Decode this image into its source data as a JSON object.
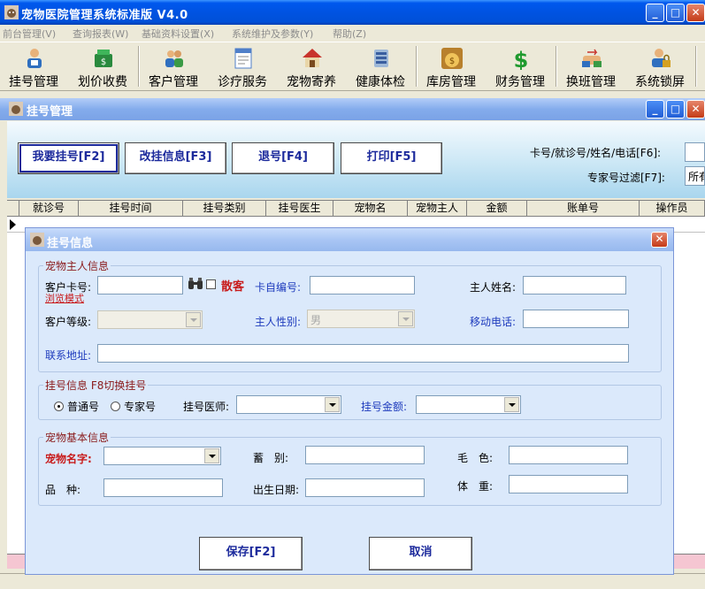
{
  "window": {
    "title": "宠物医院管理系统标准版 V4.0",
    "controls": {
      "minimize": "_",
      "maximize": "□",
      "close": "✕"
    }
  },
  "menu": [
    "前台管理(V)",
    "查询报表(W)",
    "基础资料设置(X)",
    "系统维护及参数(Y)",
    "帮助(Z)"
  ],
  "toolbar": [
    {
      "label": "挂号管理",
      "icon": "registration-person-icon"
    },
    {
      "label": "划价收费",
      "icon": "cash-register-icon"
    },
    {
      "label": "客户管理",
      "icon": "customers-icon"
    },
    {
      "label": "诊疗服务",
      "icon": "document-service-icon"
    },
    {
      "label": "宠物寄养",
      "icon": "pet-house-icon"
    },
    {
      "label": "健康体检",
      "icon": "health-check-icon"
    },
    {
      "label": "库房管理",
      "icon": "money-bag-icon"
    },
    {
      "label": "财务管理",
      "icon": "dollar-icon"
    },
    {
      "label": "换班管理",
      "icon": "shift-handover-icon"
    },
    {
      "label": "系统锁屏",
      "icon": "lock-screen-icon"
    }
  ],
  "inner_window": {
    "title": "挂号管理",
    "buttons": {
      "register": "我要挂号[F2]",
      "edit": "改挂信息[F3]",
      "cancel": "退号[F4]",
      "print": "打印[F5]"
    },
    "search_label": "卡号/就诊号/姓名/电话[F6]:",
    "filter_label": "专家号过滤[F7]:",
    "filter_value": "所有"
  },
  "grid": {
    "columns": [
      "就诊号",
      "挂号时间",
      "挂号类别",
      "挂号医生",
      "宠物名",
      "宠物主人",
      "金额",
      "账单号",
      "操作员"
    ]
  },
  "dialog": {
    "title": "挂号信息",
    "owner_section": {
      "legend": "宠物主人信息",
      "card_no_label": "客户卡号:",
      "browse_mode": "浏览模式",
      "walkin_label": "散客",
      "self_code_label": "卡自编号:",
      "owner_name_label": "主人姓名:",
      "level_label": "客户等级:",
      "gender_label": "主人性别:",
      "gender_value": "男",
      "mobile_label": "移动电话:",
      "address_label": "联系地址:"
    },
    "registration_section": {
      "legend": "挂号信息 F8切换挂号",
      "normal_label": "普通号",
      "expert_label": "专家号",
      "doctor_label": "挂号医师:",
      "amount_label": "挂号金额:"
    },
    "pet_section": {
      "legend": "宠物基本信息",
      "pet_name_label": "宠物名字:",
      "species_label": "蓄　别:",
      "coat_color_label": "毛　色:",
      "breed_label": "品　种:",
      "birth_label": "出生日期:",
      "weight_label": "体　重:"
    },
    "save_button": "保存[F2]",
    "cancel_button": "取消"
  }
}
